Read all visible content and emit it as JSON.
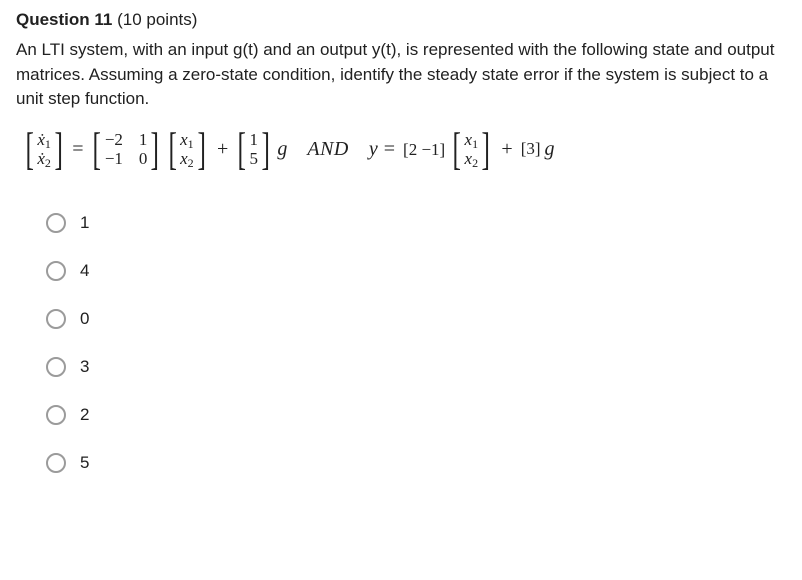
{
  "question": {
    "title_label": "Question 11",
    "points_label": "(10 points)",
    "prompt": "An LTI system, with an input g(t) and an output y(t), is represented with the following state and output matrices. Assuming a zero-state condition, identify the steady state error if the system is subject to a unit step function."
  },
  "math": {
    "xdot_top": "ẋ",
    "xdot_sub1": "1",
    "xdot_sub2": "2",
    "eq": "=",
    "A_r1c1": "−2",
    "A_r1c2": "1",
    "A_r2c1": "−1",
    "A_r2c2": "0",
    "x_label": "x",
    "x_sub1": "1",
    "x_sub2": "2",
    "plus": "+",
    "B_r1": "1",
    "B_r2": "5",
    "g": "g",
    "and": "AND",
    "y": "y",
    "C_row": "[2   −1]",
    "D": "[3]"
  },
  "options": {
    "o1": "1",
    "o2": "4",
    "o3": "0",
    "o4": "3",
    "o5": "2",
    "o6": "5"
  }
}
